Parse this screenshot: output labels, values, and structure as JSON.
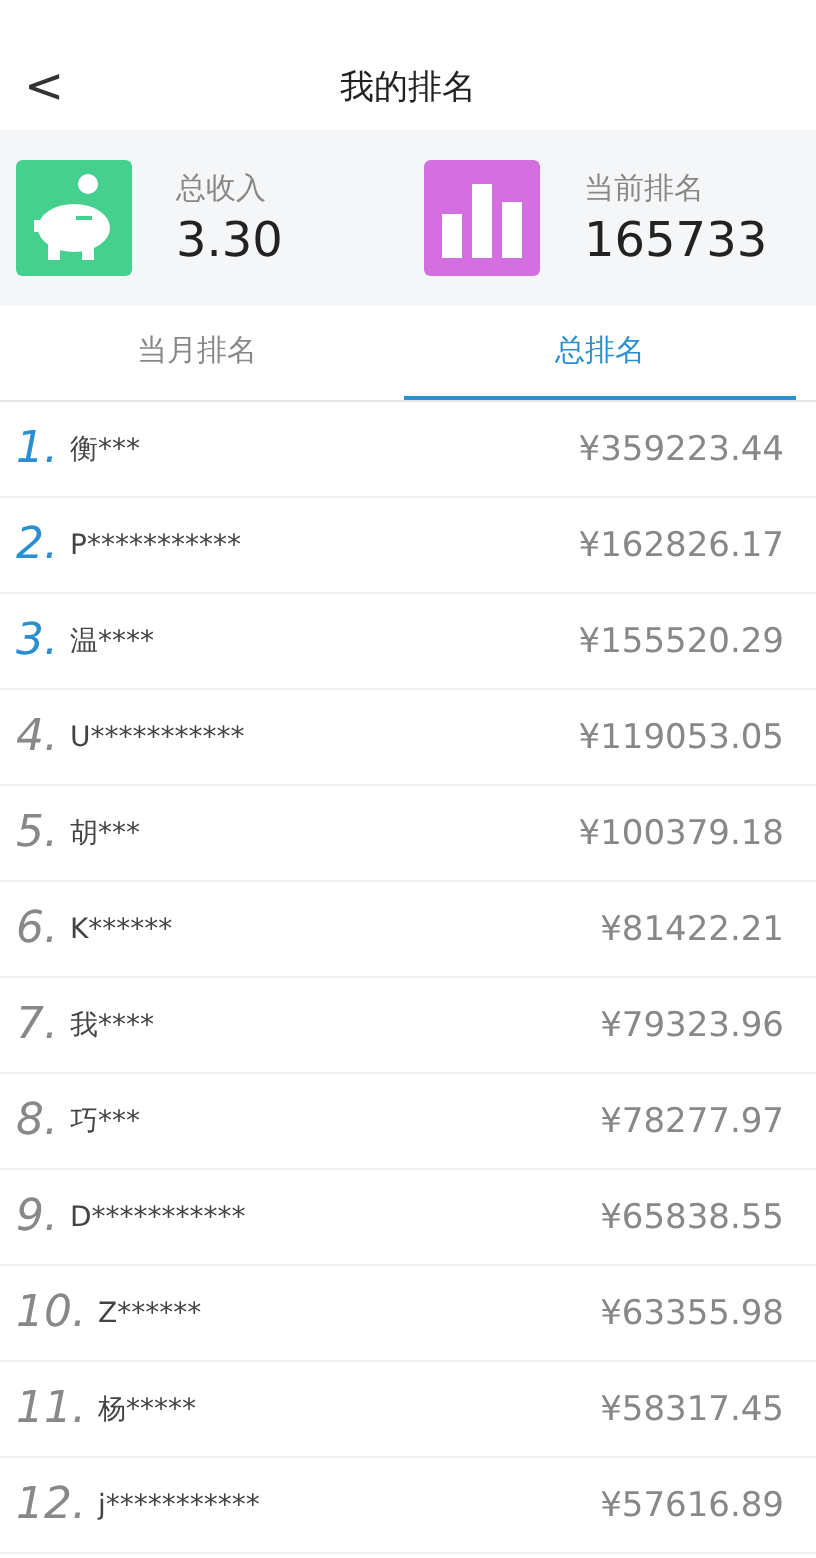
{
  "header": {
    "back": "<",
    "title": "我的排名"
  },
  "stats": [
    {
      "kind": "piggy",
      "label": "总收入",
      "value": "3.30"
    },
    {
      "kind": "chart",
      "label": "当前排名",
      "value": "165733"
    }
  ],
  "tabs": [
    {
      "label": "当月排名",
      "selected": false
    },
    {
      "label": "总排名",
      "selected": true
    }
  ],
  "rows": [
    {
      "rank": "1.",
      "name": "衡***",
      "amount": "¥359223.44",
      "highlighted": true
    },
    {
      "rank": "2.",
      "name": "P***********",
      "amount": "¥162826.17",
      "highlighted": true
    },
    {
      "rank": "3.",
      "name": "温****",
      "amount": "¥155520.29",
      "highlighted": true
    },
    {
      "rank": "4.",
      "name": "U***********",
      "amount": "¥119053.05",
      "highlighted": false
    },
    {
      "rank": "5.",
      "name": "胡***",
      "amount": "¥100379.18",
      "highlighted": false
    },
    {
      "rank": "6.",
      "name": "K******",
      "amount": "¥81422.21",
      "highlighted": false
    },
    {
      "rank": "7.",
      "name": "我****",
      "amount": "¥79323.96",
      "highlighted": false
    },
    {
      "rank": "8.",
      "name": "巧***",
      "amount": "¥78277.97",
      "highlighted": false
    },
    {
      "rank": "9.",
      "name": "D***********",
      "amount": "¥65838.55",
      "highlighted": false
    },
    {
      "rank": "10.",
      "name": "Z******",
      "amount": "¥63355.98",
      "highlighted": false
    },
    {
      "rank": "11.",
      "name": "杨*****",
      "amount": "¥58317.45",
      "highlighted": false
    },
    {
      "rank": "12.",
      "name": "j***********",
      "amount": "¥57616.89",
      "highlighted": false
    }
  ]
}
